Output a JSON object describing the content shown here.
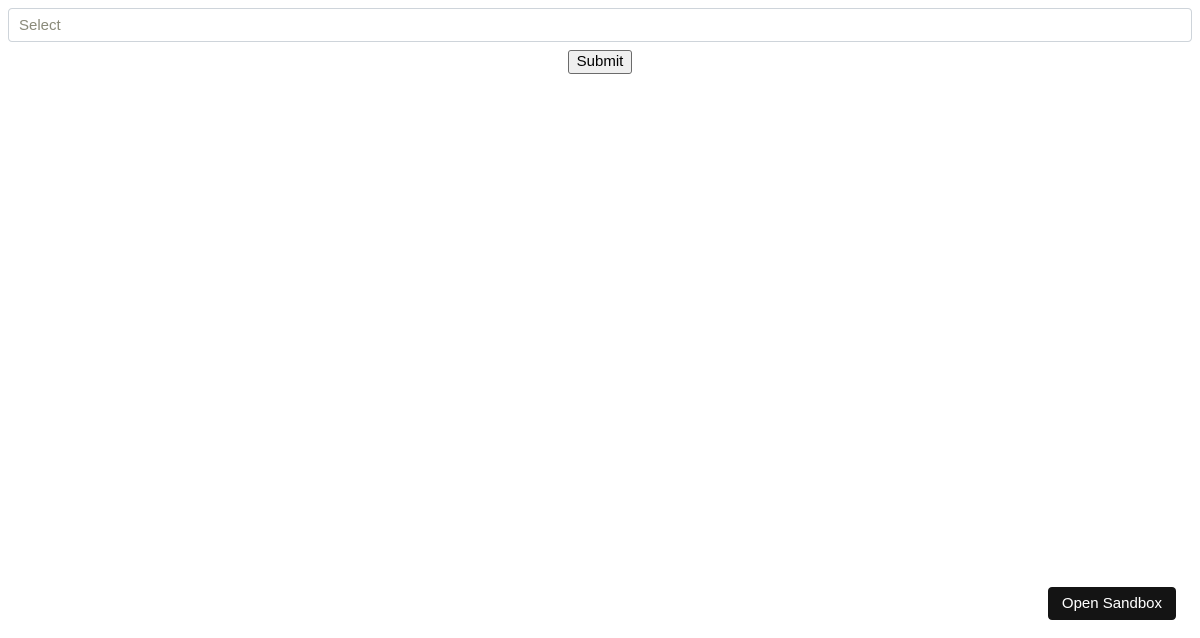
{
  "form": {
    "select_placeholder": "Select",
    "submit_label": "Submit"
  },
  "sandbox": {
    "open_label": "Open Sandbox"
  }
}
